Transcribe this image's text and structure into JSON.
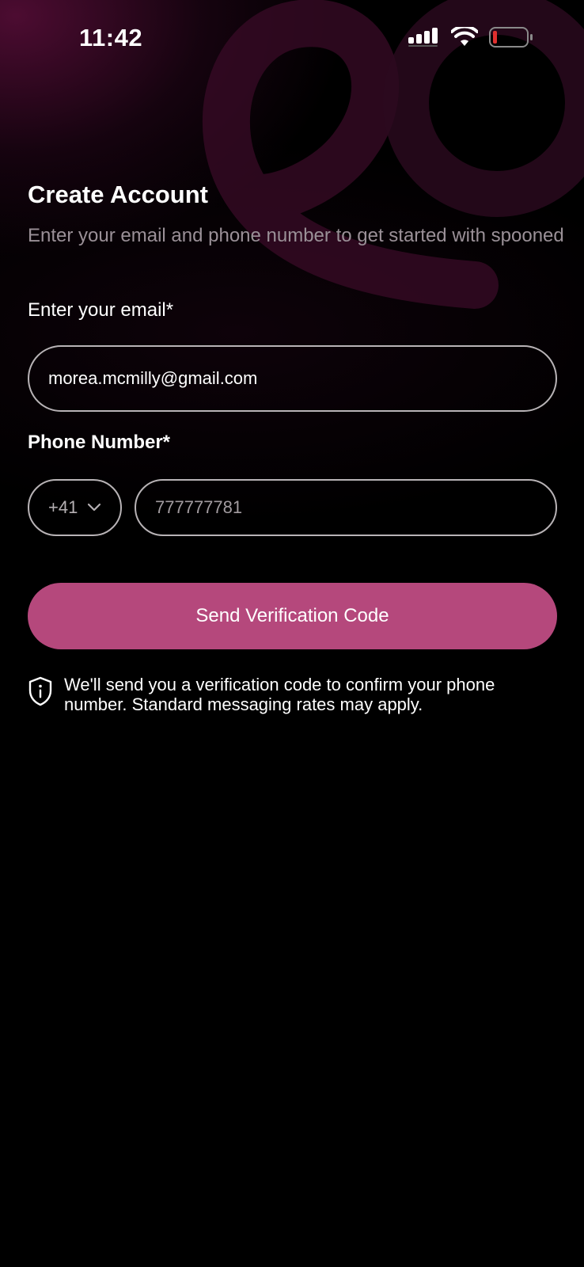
{
  "status_bar": {
    "time": "11:42"
  },
  "header": {
    "title": "Create Account",
    "subtitle": "Enter your email and phone number to get started with spooned"
  },
  "form": {
    "email_label": "Enter your email*",
    "email_value": "morea.mcmilly@gmail.com",
    "phone_label": "Phone Number*",
    "country_code": "+41",
    "phone_value": "777777781",
    "submit_label": "Send Verification Code"
  },
  "info": {
    "text": "We'll send you a verification code to confirm your phone number. Standard messaging rates may apply."
  },
  "colors": {
    "accent": "#b5487c",
    "background": "#000000",
    "battery_low": "#e0302f"
  },
  "icons": [
    "signal-icon",
    "wifi-icon",
    "battery-icon",
    "chevron-down-icon",
    "shield-info-icon"
  ]
}
